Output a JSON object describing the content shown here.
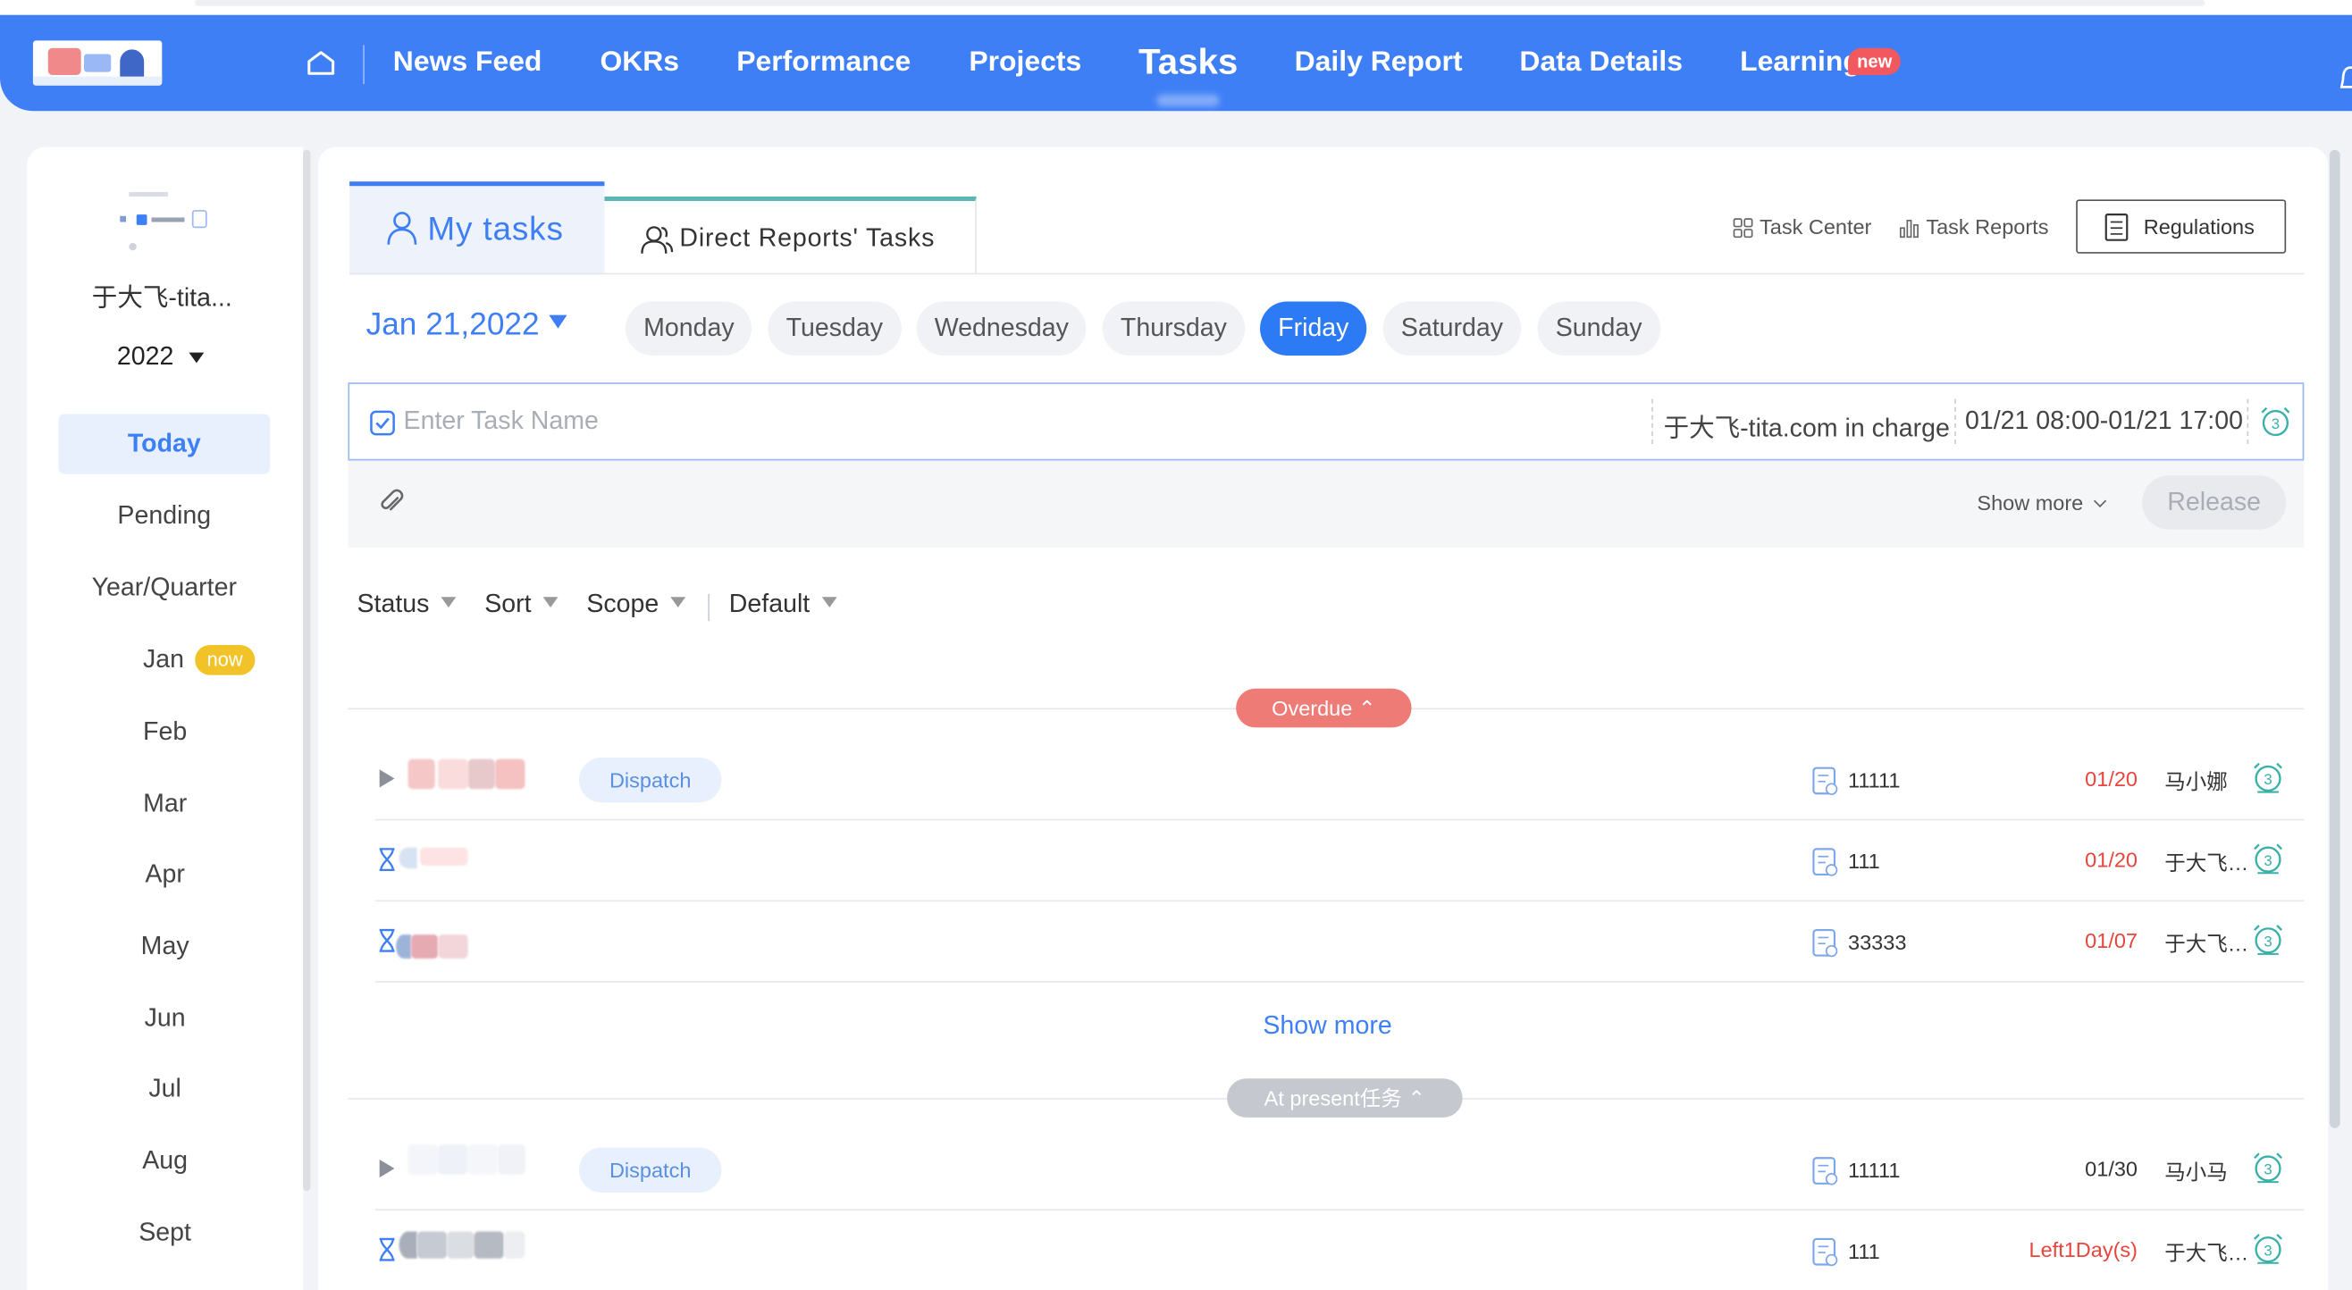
{
  "nav": {
    "items": [
      "News Feed",
      "OKRs",
      "Performance",
      "Projects",
      "Tasks",
      "Daily Report",
      "Data Details",
      "Learning"
    ],
    "active": "Tasks",
    "new_badge": "new",
    "brand_color": "#3f7ff6"
  },
  "sidebar": {
    "user_name": "于大飞-tita...",
    "year": "2022",
    "items": [
      "Today",
      "Pending",
      "Year/Quarter"
    ],
    "active": "Today",
    "months": [
      "Jan",
      "Feb",
      "Mar",
      "Apr",
      "May",
      "Jun",
      "Jul",
      "Aug",
      "Sept"
    ],
    "now_badge": "now"
  },
  "tabs": {
    "my_tasks": "My  tasks",
    "direct_reports": "Direct  Reports'  Tasks"
  },
  "toolbar": {
    "task_center": "Task Center",
    "task_reports": "Task Reports",
    "regulations": "Regulations"
  },
  "date": {
    "current": "Jan 21,2022",
    "days": [
      "Monday",
      "Tuesday",
      "Wednesday",
      "Thursday",
      "Friday",
      "Saturday",
      "Sunday"
    ],
    "active_day": "Friday"
  },
  "new_task": {
    "placeholder": "Enter Task Name",
    "in_charge": "于大飞-tita.com in charge",
    "time_range": "01/21 08:00-01/21 17:00",
    "alarm_count": "3",
    "show_more": "Show more",
    "release": "Release"
  },
  "filters": [
    "Status",
    "Sort",
    "Scope",
    "Default"
  ],
  "groups": {
    "overdue": {
      "label": "Overdue",
      "color": "#ef7b76",
      "tasks": [
        {
          "tag": "Dispatch",
          "project": "11111",
          "due": "01/20",
          "due_color": "#e8453c",
          "owner": "马小娜",
          "alarm": "3"
        },
        {
          "tag": "",
          "project": "111",
          "due": "01/20",
          "due_color": "#e8453c",
          "owner": "于大飞-tita.com",
          "alarm": "3"
        },
        {
          "tag": "",
          "project": "33333",
          "due": "01/07",
          "due_color": "#e8453c",
          "owner": "于大飞-tita.com",
          "alarm": "3"
        }
      ],
      "show_more": "Show more"
    },
    "present": {
      "label": "At present任务",
      "color": "#c5c9cf",
      "tasks": [
        {
          "tag": "Dispatch",
          "project": "11111",
          "due": "01/30",
          "due_color": "#333333",
          "owner": "马小马",
          "alarm": "3"
        },
        {
          "tag": "",
          "project": "111",
          "due": "Left1Day(s)",
          "due_color": "#e8453c",
          "owner": "于大飞-tita.com",
          "alarm": "3"
        }
      ]
    }
  }
}
